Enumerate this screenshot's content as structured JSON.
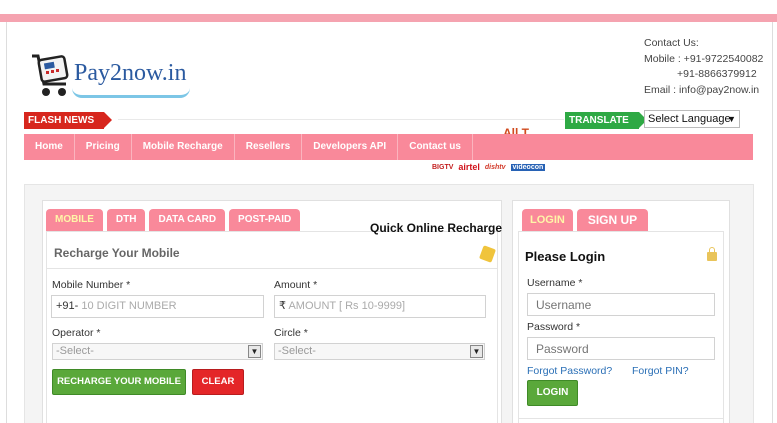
{
  "brand": {
    "name": "Pay2now.in"
  },
  "contact": {
    "heading": "Contact Us:",
    "mobile1": "Mobile : +91-9722540082",
    "mobile2": "+91-8866379912",
    "email": "Email : info@pay2now.in"
  },
  "flash": {
    "label": "FLASH NEWS",
    "ticker": "All T"
  },
  "translate": {
    "label": "TRANSLATE",
    "select_value": "Select Language"
  },
  "nav": [
    "Home",
    "Pricing",
    "Mobile Recharge",
    "Resellers",
    "Developers API",
    "Contact us"
  ],
  "operators_strip": [
    "BIGTV",
    "airtel",
    "dishtv",
    "videocon"
  ],
  "recharge": {
    "tabs": [
      "MOBILE",
      "DTH",
      "DATA CARD",
      "POST-PAID"
    ],
    "active_tab": "MOBILE",
    "quick_title": "Quick Online Recharge",
    "form_title": "Recharge Your Mobile",
    "mobile_label": "Mobile Number *",
    "mobile_prefix": "+91-",
    "mobile_placeholder": "10 DIGIT NUMBER",
    "amount_label": "Amount *",
    "amount_prefix": "₹",
    "amount_placeholder": "AMOUNT [ Rs 10-9999]",
    "operator_label": "Operator *",
    "operator_value": "-Select-",
    "circle_label": "Circle *",
    "circle_value": "-Select-",
    "recharge_button": "RECHARGE YOUR MOBILE",
    "clear_button": "CLEAR"
  },
  "login": {
    "tabs": [
      "LOGIN",
      "SIGN UP"
    ],
    "active_tab": "LOGIN",
    "title": "Please Login",
    "username_label": "Username *",
    "username_placeholder": "Username",
    "password_label": "Password *",
    "password_placeholder": "Password",
    "forgot_password": "Forgot Password?",
    "forgot_pin": "Forgot PIN?",
    "login_button": "LOGIN"
  },
  "colors": {
    "accent_pink": "#f9899a",
    "flash_red": "#d7261d",
    "translate_green": "#2ea944",
    "button_green": "#5aa83a",
    "button_red": "#e42628",
    "link_blue": "#2a6fb6"
  }
}
